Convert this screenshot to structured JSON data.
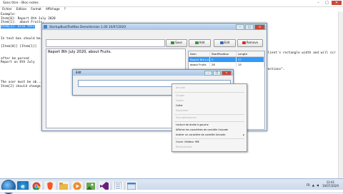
{
  "notepad": {
    "title": "Sans titre - Bloc-notes",
    "menu": [
      "Fichier",
      "Edition",
      "Format",
      "Affichage",
      "?"
    ],
    "lines": [
      "Example:",
      "Item[0]: Report 8th July 2020",
      "Item[1]:  about Fruits.",
      "Item[2]: ...",
      "",
      "",
      "",
      "",
      "In text box should be...",
      "",
      "[Item[0]] [Item[1]]",
      "",
      "",
      "after be parsed",
      "Report on 8th July",
      "",
      "",
      "",
      "",
      "The user must be ab...",
      "Item[2] should change..."
    ],
    "selected_line": "Item[3]: also this",
    "right_fragment_1": "client's rectangle width and will scr",
    "right_fragment_2": "rections\"."
  },
  "main_window": {
    "title": "StartupBuzzTextBox DemoVersion 1.00 10/07/2020",
    "search_value": "",
    "save_label": "Save",
    "add_label": "Add",
    "edit_label": "Edit",
    "remove_label": "Remove",
    "text_content": "Report 8th July 2020, about Fruits.",
    "list_headers": [
      "Item",
      "StartPosition",
      "Length"
    ],
    "list_rows": [
      {
        "item": "Report 8th Jul...",
        "start": "0",
        "length": "27"
      },
      {
        "item": "about Fruits",
        "start": "28",
        "length": "15"
      }
    ]
  },
  "edit_dialog": {
    "title": "Edit",
    "value": ""
  },
  "context_menu": {
    "items": [
      {
        "label": "Annuler",
        "disabled": true
      },
      {
        "label": "Couper",
        "disabled": true
      },
      {
        "label": "Copier",
        "disabled": true
      },
      {
        "label": "Coller",
        "disabled": false
      },
      {
        "label": "Supprimer",
        "disabled": true
      },
      {
        "label": "Tout sélectionner",
        "disabled": true
      },
      {
        "label": "Lecture de droite à gauche",
        "disabled": false
      },
      {
        "label": "Afficher les caractères de contrôle Unicode",
        "disabled": false
      },
      {
        "label": "Insérer un caractère de contrôle Unicode",
        "disabled": false
      },
      {
        "label": "Ouvrir l'éditeur IME",
        "disabled": false
      },
      {
        "label": "Reconversion",
        "disabled": true
      }
    ]
  },
  "taskbar": {
    "lang": "FR",
    "time": "12:41",
    "date": "10/07/2020"
  },
  "colors": {
    "selection": "#3399ff",
    "title_gradient": "#a9c4e6",
    "close_red": "#c74b3c"
  }
}
